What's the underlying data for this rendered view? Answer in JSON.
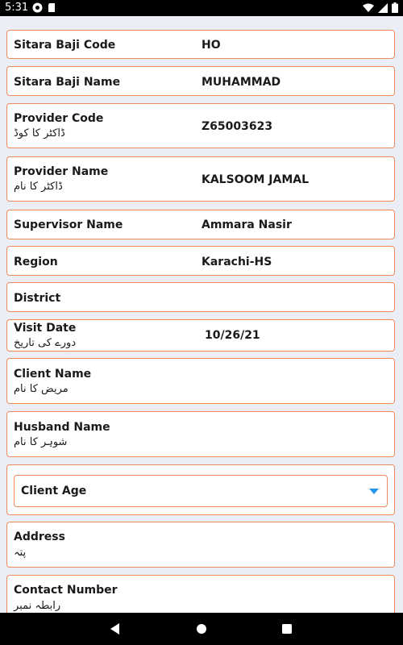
{
  "status_bar": {
    "time": "5:31"
  },
  "fields": {
    "sitara_baji_code": {
      "label": "Sitara Baji Code",
      "value": "HO"
    },
    "sitara_baji_name": {
      "label": "Sitara Baji Name",
      "value": "MUHAMMAD"
    },
    "provider_code": {
      "label": "Provider Code",
      "label_ur": "ڈاکٹر کا کوڈ",
      "value": "Z65003623"
    },
    "provider_name": {
      "label": "Provider Name",
      "label_ur": "ڈاکٹر کا نام",
      "value": "KALSOOM JAMAL"
    },
    "supervisor_name": {
      "label": "Supervisor Name",
      "value": "Ammara Nasir"
    },
    "region": {
      "label": "Region",
      "value": "Karachi-HS"
    },
    "district": {
      "label": "District",
      "value": ""
    },
    "visit_date": {
      "label": "Visit Date",
      "label_ur": "دورے کی تاریخ",
      "value": "10/26/21"
    },
    "client_name": {
      "label": "Client Name",
      "label_ur": "مریض کا نام"
    },
    "husband_name": {
      "label": "Husband Name",
      "label_ur": "شوہر کا نام"
    },
    "client_age": {
      "label": "Client Age"
    },
    "address": {
      "label": "Address",
      "label_ur": "پتہ"
    },
    "contact_number": {
      "label": "Contact Number",
      "label_ur": "رابطہ نمبر"
    }
  },
  "colors": {
    "card_border": "#f08a5a",
    "background": "#ebeef7",
    "dropdown_arrow": "#2196f3"
  },
  "icons": {
    "dropdown": "chevron-down-icon",
    "nav_back": "back-triangle-icon",
    "nav_home": "home-circle-icon",
    "nav_recents": "recents-square-icon"
  }
}
